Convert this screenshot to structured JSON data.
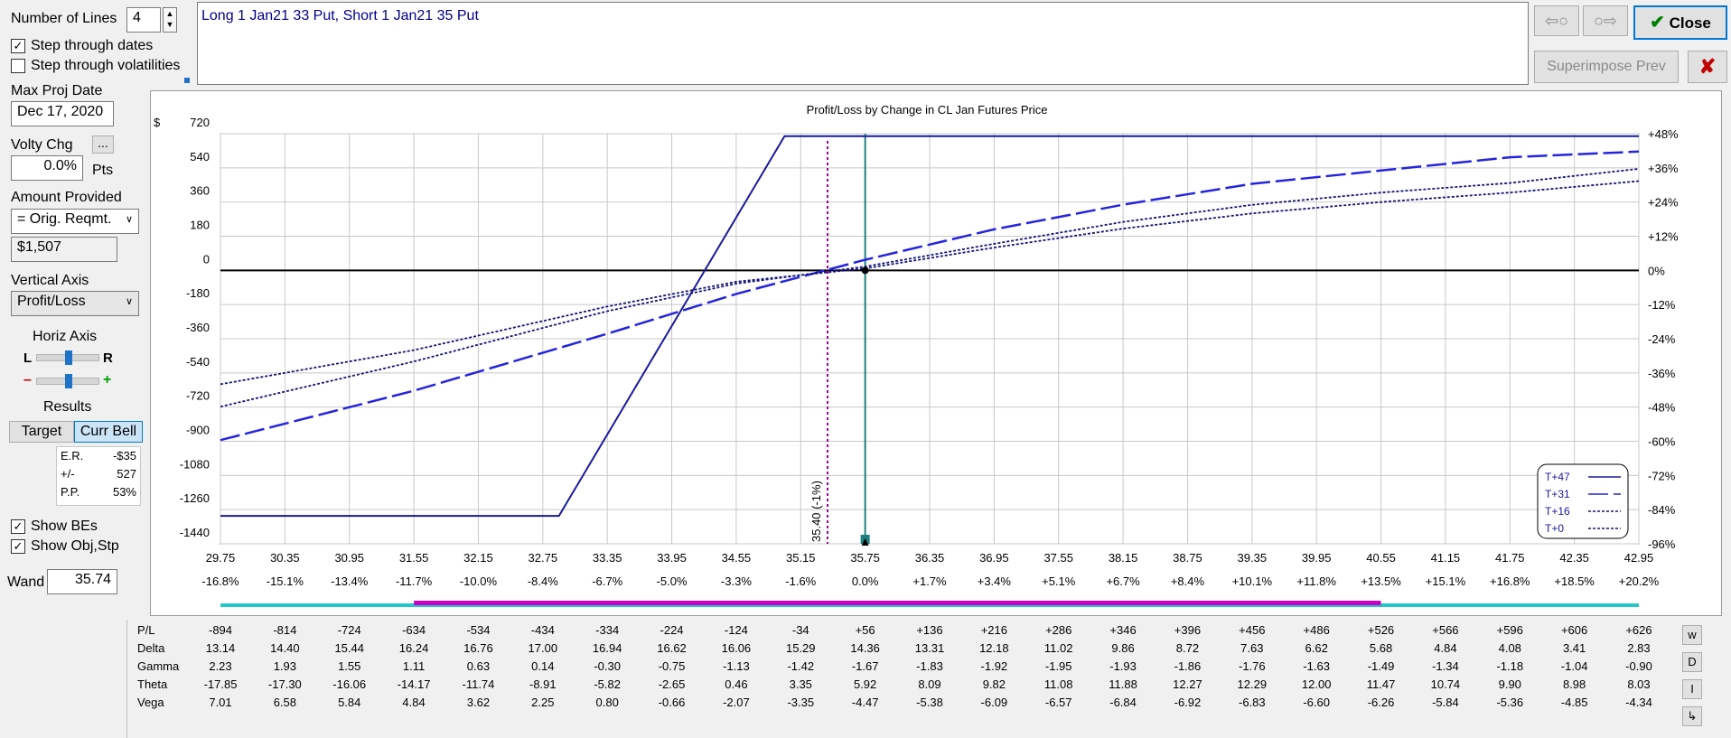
{
  "left_panel": {
    "num_lines_label": "Number of Lines",
    "num_lines_value": "4",
    "step_dates_label": "Step through dates",
    "step_dates_checked": true,
    "step_vols_label": "Step through volatilities",
    "step_vols_checked": false,
    "max_proj_date_label": "Max Proj Date",
    "max_proj_date_value": "Dec 17, 2020",
    "volty_chg_label": "Volty Chg",
    "volty_more_label": "...",
    "volty_value": "0.0%",
    "volty_unit": "Pts",
    "amount_provided_label": "Amount Provided",
    "amount_provided_selected": "= Orig. Reqmt.",
    "amount_value": "$1,507",
    "vertical_axis_label": "Vertical Axis",
    "vertical_axis_selected": "Profit/Loss",
    "horiz_axis_label": "Horiz Axis",
    "horiz_left": "L",
    "horiz_right": "R",
    "horiz_minus": "–",
    "horiz_plus": "+",
    "results_label": "Results",
    "target_button": "Target",
    "curr_bell_button": "Curr Bell",
    "results": [
      {
        "name": "E.R.",
        "value": "-$35"
      },
      {
        "name": "+/-",
        "value": "527"
      },
      {
        "name": "P.P.",
        "value": "53%"
      }
    ],
    "show_bes_label": "Show BEs",
    "show_bes_checked": true,
    "show_obj_label": "Show Obj,Stp",
    "show_obj_checked": true,
    "wand_label": "Wand",
    "wand_value": "35.74"
  },
  "position_text": "Long 1 Jan21 33 Put, Short 1 Jan21 35 Put",
  "top_buttons": {
    "back_icon": "⇦○",
    "fwd_icon": "○⇨",
    "close_check_icon": "✔",
    "close_label": "Close",
    "superimpose_label": "Superimpose Prev",
    "cancel_icon": "✘"
  },
  "chart_data": {
    "type": "line",
    "title": "Profit/Loss by Change in CL Jan Futures Price",
    "y_unit": "$",
    "ylim": [
      -1440,
      720
    ],
    "xlim": [
      29.75,
      42.95
    ],
    "y_ticks": [
      720,
      540,
      360,
      180,
      0,
      -180,
      -360,
      -540,
      -720,
      -900,
      -1080,
      -1260,
      -1440
    ],
    "y_right_ticks": [
      "+48%",
      "+36%",
      "+24%",
      "+12%",
      "0%",
      "-12%",
      "-24%",
      "-36%",
      "-48%",
      "-60%",
      "-72%",
      "-84%",
      "-96%"
    ],
    "x_ticks": [
      "29.75",
      "30.35",
      "30.95",
      "31.55",
      "32.15",
      "32.75",
      "33.35",
      "33.95",
      "34.55",
      "35.15",
      "35.75",
      "36.35",
      "36.95",
      "37.55",
      "38.15",
      "38.75",
      "39.35",
      "39.95",
      "40.55",
      "41.15",
      "41.75",
      "42.35",
      "42.95"
    ],
    "x_pct_ticks": [
      "-16.8%",
      "-15.1%",
      "-13.4%",
      "-11.7%",
      "-10.0%",
      "-8.4%",
      "-6.7%",
      "-5.0%",
      "-3.3%",
      "-1.6%",
      "0.0%",
      "+1.7%",
      "+3.4%",
      "+5.1%",
      "+6.7%",
      "+8.4%",
      "+10.1%",
      "+11.8%",
      "+13.5%",
      "+15.1%",
      "+16.8%",
      "+18.5%",
      "+20.2%"
    ],
    "breakeven_label": "35.40 (-1%)",
    "breakeven_x": 35.4,
    "current_x": 35.75,
    "grid": true,
    "legend_position": "bottom-right",
    "series": [
      {
        "name": "T+47",
        "style": "solid",
        "x": [
          29.75,
          32.9,
          35.0,
          42.95
        ],
        "y": [
          -1293,
          -1293,
          707,
          707
        ]
      },
      {
        "name": "T+31",
        "style": "long-dash",
        "x": [
          29.75,
          31.55,
          33.35,
          34.55,
          35.75,
          36.95,
          38.15,
          39.35,
          40.55,
          41.75,
          42.95
        ],
        "y": [
          -894,
          -634,
          -334,
          -124,
          56,
          216,
          346,
          456,
          526,
          596,
          626
        ]
      },
      {
        "name": "T+16",
        "style": "dotted",
        "x": [
          29.75,
          31.55,
          33.35,
          34.55,
          35.75,
          36.95,
          38.15,
          39.35,
          40.55,
          41.75,
          42.95
        ],
        "y": [
          -718,
          -480,
          -215,
          -70,
          20,
          140,
          255,
          345,
          410,
          460,
          535
        ]
      },
      {
        "name": "T+0",
        "style": "dotted",
        "x": [
          29.75,
          31.55,
          33.35,
          34.55,
          35.75,
          36.95,
          38.15,
          39.35,
          40.55,
          41.75,
          42.95
        ],
        "y": [
          -600,
          -420,
          -190,
          -60,
          10,
          120,
          220,
          300,
          360,
          410,
          470
        ]
      }
    ],
    "bars": {
      "cyan_range": [
        29.75,
        42.95
      ],
      "magenta_range": [
        31.55,
        40.55
      ]
    }
  },
  "data_table": {
    "rows": [
      {
        "label": "P/L",
        "values": [
          "-894",
          "-814",
          "-724",
          "-634",
          "-534",
          "-434",
          "-334",
          "-224",
          "-124",
          "-34",
          "+56",
          "+136",
          "+216",
          "+286",
          "+346",
          "+396",
          "+456",
          "+486",
          "+526",
          "+566",
          "+596",
          "+606",
          "+626"
        ]
      },
      {
        "label": "Delta",
        "values": [
          "13.14",
          "14.40",
          "15.44",
          "16.24",
          "16.76",
          "17.00",
          "16.94",
          "16.62",
          "16.06",
          "15.29",
          "14.36",
          "13.31",
          "12.18",
          "11.02",
          "9.86",
          "8.72",
          "7.63",
          "6.62",
          "5.68",
          "4.84",
          "4.08",
          "3.41",
          "2.83"
        ]
      },
      {
        "label": "Gamma",
        "values": [
          "2.23",
          "1.93",
          "1.55",
          "1.11",
          "0.63",
          "0.14",
          "-0.30",
          "-0.75",
          "-1.13",
          "-1.42",
          "-1.67",
          "-1.83",
          "-1.92",
          "-1.95",
          "-1.93",
          "-1.86",
          "-1.76",
          "-1.63",
          "-1.49",
          "-1.34",
          "-1.18",
          "-1.04",
          "-0.90"
        ]
      },
      {
        "label": "Theta",
        "values": [
          "-17.85",
          "-17.30",
          "-16.06",
          "-14.17",
          "-11.74",
          "-8.91",
          "-5.82",
          "-2.65",
          "0.46",
          "3.35",
          "5.92",
          "8.09",
          "9.82",
          "11.08",
          "11.88",
          "12.27",
          "12.29",
          "12.00",
          "11.47",
          "10.74",
          "9.90",
          "8.98",
          "8.03"
        ]
      },
      {
        "label": "Vega",
        "values": [
          "7.01",
          "6.58",
          "5.84",
          "4.84",
          "3.62",
          "2.25",
          "0.80",
          "-0.66",
          "-2.07",
          "-3.35",
          "-4.47",
          "-5.38",
          "-6.09",
          "-6.57",
          "-6.84",
          "-6.92",
          "-6.83",
          "-6.60",
          "-6.26",
          "-5.84",
          "-5.36",
          "-4.85",
          "-4.34"
        ]
      }
    ],
    "side_buttons": [
      "w",
      "D",
      "I",
      "↳"
    ]
  }
}
